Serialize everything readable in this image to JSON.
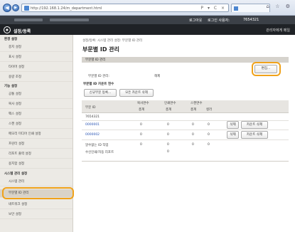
{
  "browser": {
    "url": "http://192.168.1.24/m_department.html",
    "tools": "P ▾ C ×",
    "chrome_icons": "⌂ ☆ ⚙"
  },
  "topbar": {
    "login_label": "로그인 사용자:",
    "login_user": "7654321",
    "logout": "로그아웃"
  },
  "brand": {
    "title": "설정/등록",
    "right": "관리자에게 메일"
  },
  "sidebar": {
    "groups": [
      {
        "title": "환경 설정",
        "items": [
          "종지 설정",
          "표시 설정",
          "타이머 설정",
          "용량 조정"
        ]
      },
      {
        "title": "기능 설정",
        "items": [
          "공통 설정",
          "복사 설정",
          "팩스 설정",
          "스캔 설정",
          "메모리 미디어 인쇄 설정",
          "프린터 설정",
          "리포트 출력 설정",
          "용지함 설정"
        ]
      },
      {
        "title": "시스템 관리 설정",
        "items": [
          "시스템 관리",
          "부문별 ID 관리",
          "네트워크 설정",
          "보안 설정"
        ]
      }
    ]
  },
  "main": {
    "breadcrumb": "설정/등록: 시스템 관리 설정: 부문별 ID 관리",
    "title": "부문별 ID 관리",
    "section": "부문별 ID 관리",
    "edit_button": "편집...",
    "setting_label": "부문별 ID 관리:",
    "setting_value": "해제",
    "counter_heading": "부문별 ID 카운트 현수",
    "register_button": "신규부문 등록...",
    "clear_all_button": "모든 카운트 삭제",
    "columns": {
      "id": "부문 ID",
      "copy": "복사면수",
      "print": "인쇄면수",
      "scan": "스캔면수",
      "total": "총계",
      "color": "컬러"
    },
    "rows": [
      {
        "id": "7654321",
        "copy": "",
        "print": "",
        "scan_total": "",
        "scan_color": "",
        "link": false,
        "delete": "",
        "clear": ""
      },
      {
        "id": "0000001",
        "copy": "0",
        "print": "0",
        "scan_total": "0",
        "scan_color": "0",
        "link": true,
        "delete": "삭제",
        "clear": "카운트 삭제"
      },
      {
        "id": "0000002",
        "copy": "0",
        "print": "0",
        "scan_total": "0",
        "scan_color": "0",
        "link": true,
        "delete": "삭제",
        "clear": "카운트 삭제"
      },
      {
        "id": "알수없는 ID 작업",
        "copy": "0",
        "print": "0",
        "scan_total": "0",
        "scan_color": "0",
        "link": false,
        "delete": "",
        "clear": ""
      },
      {
        "id": "수신인쇄/자동 리포트",
        "copy": "",
        "print": "0",
        "scan_total": "",
        "scan_color": "",
        "link": false,
        "delete": "",
        "clear": ""
      }
    ]
  }
}
